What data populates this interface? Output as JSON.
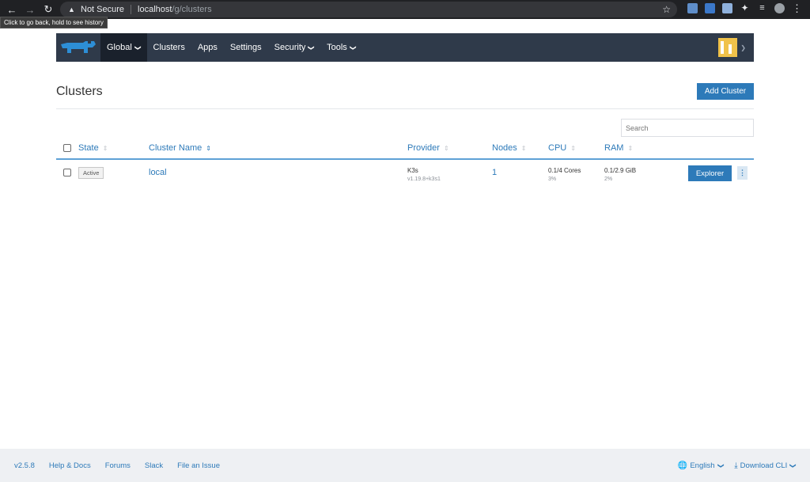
{
  "browser": {
    "not_secure": "Not Secure",
    "url_host": "localhost",
    "url_path": "/g/clusters",
    "tooltip": "Click to go back, hold to see history"
  },
  "header": {
    "menu": [
      {
        "label": "Global",
        "dropdown": true,
        "active": true
      },
      {
        "label": "Clusters"
      },
      {
        "label": "Apps"
      },
      {
        "label": "Settings"
      },
      {
        "label": "Security",
        "dropdown": true
      },
      {
        "label": "Tools",
        "dropdown": true
      }
    ]
  },
  "page": {
    "title": "Clusters",
    "add_button": "Add Cluster",
    "search_placeholder": "Search"
  },
  "table": {
    "columns": [
      "State",
      "Cluster Name",
      "Provider",
      "Nodes",
      "CPU",
      "RAM"
    ],
    "rows": [
      {
        "state": "Active",
        "name": "local",
        "provider": "K3s",
        "provider_version": "v1.19.8+k3s1",
        "nodes": "1",
        "cpu": "0.1/4 Cores",
        "cpu_pct": "3%",
        "ram": "0.1/2.9 GiB",
        "ram_pct": "2%",
        "action": "Explorer"
      }
    ]
  },
  "footer": {
    "version": "v2.5.8",
    "links": [
      "Help & Docs",
      "Forums",
      "Slack",
      "File an Issue"
    ],
    "language": "English",
    "download": "Download CLI"
  },
  "colors": {
    "accent": "#2d7ab9",
    "header_bg": "#2f3a4a"
  }
}
